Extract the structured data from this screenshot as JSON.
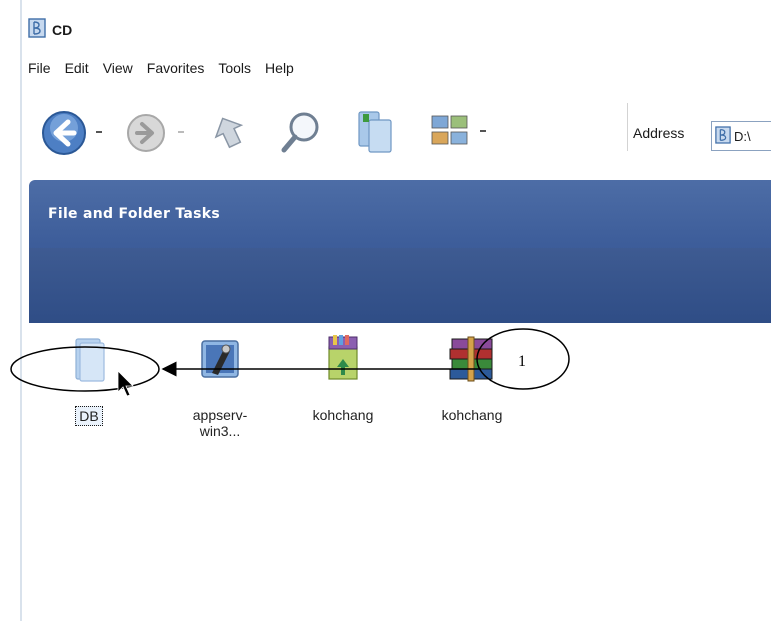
{
  "window": {
    "title": "CD"
  },
  "menu": [
    "File",
    "Edit",
    "View",
    "Favorites",
    "Tools",
    "Help"
  ],
  "toolbar": {
    "address_label": "Address",
    "address_value": "D:\\"
  },
  "tasks_panel": {
    "header": "File and Folder Tasks"
  },
  "files": [
    {
      "name": "DB",
      "icon": "folder-icon",
      "selected": true
    },
    {
      "name": "appserv-win3...",
      "icon": "installer-icon",
      "selected": false
    },
    {
      "name": "kohchang",
      "icon": "zip-archive-icon",
      "selected": false
    },
    {
      "name": "kohchang",
      "icon": "rar-archive-icon",
      "selected": false
    }
  ],
  "annotation": {
    "label": "1"
  },
  "colors": {
    "panel_blue": "#3d5d9a",
    "selection_border": "#1a1a1a"
  }
}
